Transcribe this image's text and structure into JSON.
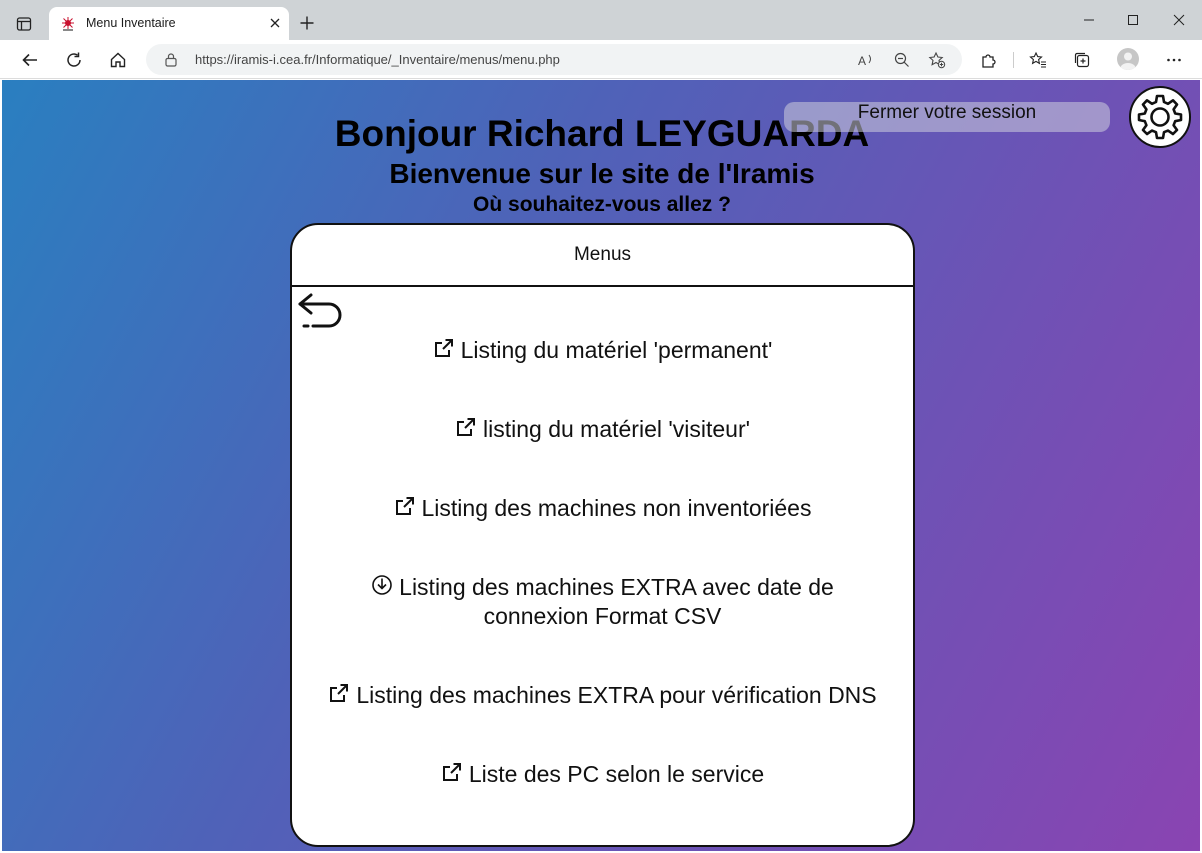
{
  "browser": {
    "tab_title": "Menu Inventaire",
    "url": "https://iramis-i.cea.fr/Informatique/_Inventaire/menus/menu.php"
  },
  "page": {
    "logout_label": "Fermer votre session",
    "greeting": "Bonjour Richard LEYGUARDA",
    "welcome": "Bienvenue sur le site de l'Iramis",
    "question": "Où souhaitez-vous allez ?",
    "menu_title": "Menus",
    "items": [
      {
        "label": "Listing du matériel 'permanent'",
        "icon": "external-link-icon"
      },
      {
        "label": "listing du matériel 'visiteur'",
        "icon": "external-link-icon"
      },
      {
        "label": "Listing des machines non inventoriées",
        "icon": "external-link-icon"
      },
      {
        "label_line1": "Listing des machines EXTRA avec date de",
        "label_line2": "connexion Format CSV",
        "icon": "download-icon"
      },
      {
        "label": "Listing des machines EXTRA pour vérification DNS",
        "icon": "external-link-icon"
      },
      {
        "label": "Liste des PC selon le service",
        "icon": "external-link-icon"
      }
    ]
  },
  "colors": {
    "gradient_start": "#2a7fc0",
    "gradient_end": "#8a44b2"
  }
}
